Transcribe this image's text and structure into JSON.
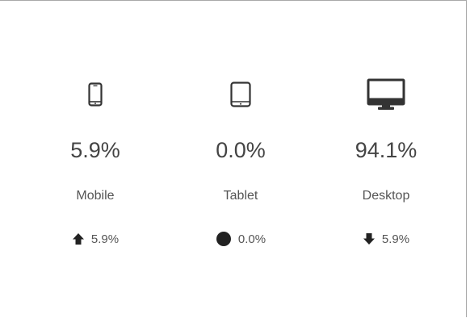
{
  "devices": [
    {
      "name": "Mobile",
      "icon": "mobile-phone-icon",
      "percent": "5.9%",
      "change": "5.9%",
      "trend": "up",
      "trend_icon": "arrow-up-icon"
    },
    {
      "name": "Tablet",
      "icon": "tablet-icon",
      "percent": "0.0%",
      "change": "0.0%",
      "trend": "neutral",
      "trend_icon": "circle-icon"
    },
    {
      "name": "Desktop",
      "icon": "desktop-monitor-icon",
      "percent": "94.1%",
      "change": "5.9%",
      "trend": "down",
      "trend_icon": "arrow-down-icon"
    }
  ],
  "colors": {
    "icon": "#333333",
    "text": "#444444",
    "border": "#a8a8a8"
  }
}
